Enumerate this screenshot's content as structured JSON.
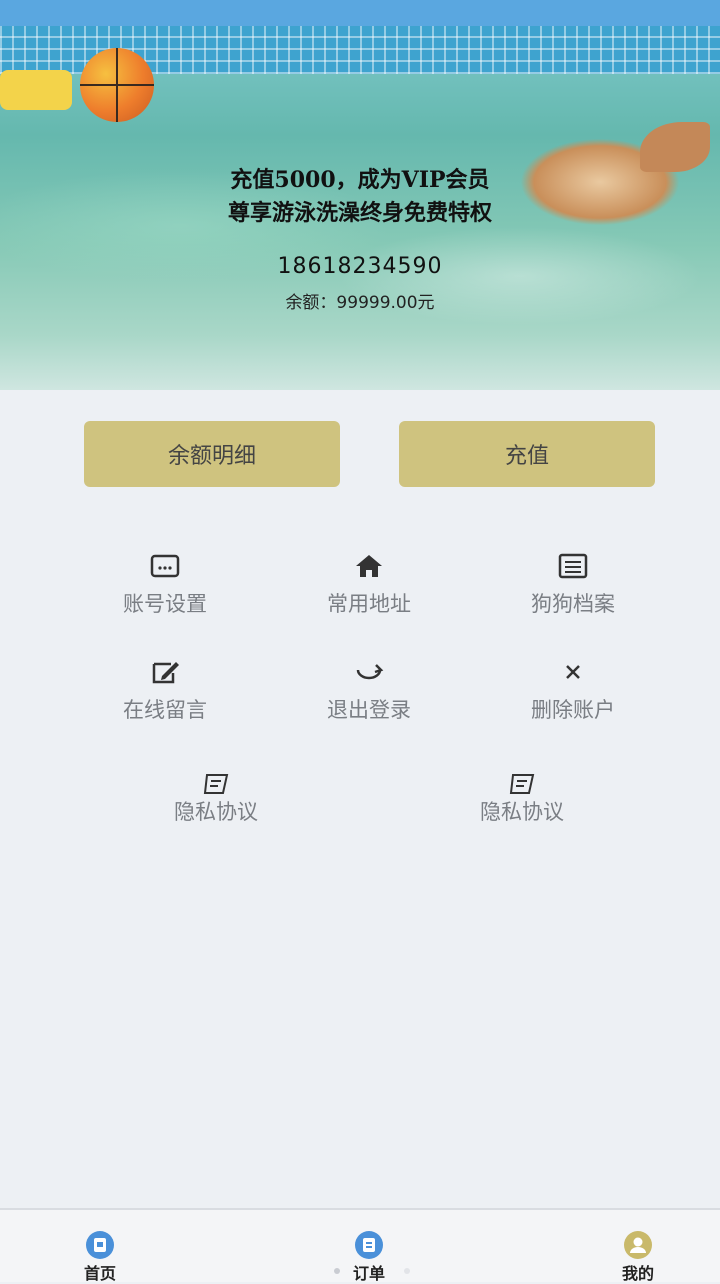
{
  "hero": {
    "promo_line1": "充值5000，成为VIP会员",
    "promo_line2": "尊享游泳洗澡终身免费特权",
    "phone": "18618234590",
    "balance": "余额：99999.00元"
  },
  "actions": {
    "detail_label": "余额明细",
    "recharge_label": "充值"
  },
  "menu": {
    "items": [
      {
        "label": "账号设置",
        "icon": "card-icon"
      },
      {
        "label": "常用地址",
        "icon": "home-icon"
      },
      {
        "label": "狗狗档案",
        "icon": "document-icon"
      },
      {
        "label": "在线留言",
        "icon": "edit-icon"
      },
      {
        "label": "退出登录",
        "icon": "logout-icon"
      },
      {
        "label": "删除账户",
        "icon": "close-icon"
      },
      {
        "label": "隐私协议",
        "icon": "privacy-icon"
      },
      {
        "label": "隐私协议",
        "icon": "privacy-icon"
      }
    ]
  },
  "tabbar": {
    "tabs": [
      {
        "label": "首页",
        "icon": "home-tab-icon"
      },
      {
        "label": "订单",
        "icon": "order-tab-icon"
      },
      {
        "label": "我的",
        "icon": "user-tab-icon"
      }
    ]
  },
  "colors": {
    "button": "#cfc37f",
    "tab_blue": "#4a90d9",
    "tab_active": "#c9b96a",
    "statusbar": "#5aa7e0"
  }
}
